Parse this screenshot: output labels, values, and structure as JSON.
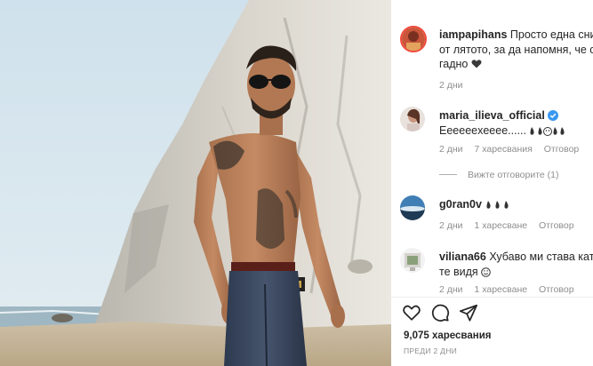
{
  "post": {
    "author": "iampapihans",
    "caption_line1": "Просто една сни",
    "caption_line2": "от лятото, за да напомня, че сег",
    "caption_line3": "гадно",
    "time": "2 дни"
  },
  "comments": [
    {
      "username": "maria_ilieva_official",
      "text": "Eeeeeexeeee......",
      "time": "2 дни",
      "likes": "7 харесвания",
      "reply_label": "Отговор",
      "view_replies": "Вижте отговорите (1)"
    },
    {
      "username": "g0ran0v",
      "time": "2 дни",
      "likes": "1 харесване",
      "reply_label": "Отговор"
    },
    {
      "username": "viliana66",
      "text_line1": "Хубаво ми става кат'",
      "text_line2": "те видя",
      "time": "2 дни",
      "likes": "1 харесване",
      "reply_label": "Отговор"
    }
  ],
  "actions": {
    "like_icon": "heart-icon",
    "comment_icon": "comment-icon",
    "share_icon": "share-icon"
  },
  "likes_count": "9,075 харесвания",
  "post_time": "ПРЕДИ 2 ДНИ",
  "colors": {
    "verified": "#3897f0",
    "muted": "#8e8e8e",
    "text": "#262626"
  }
}
